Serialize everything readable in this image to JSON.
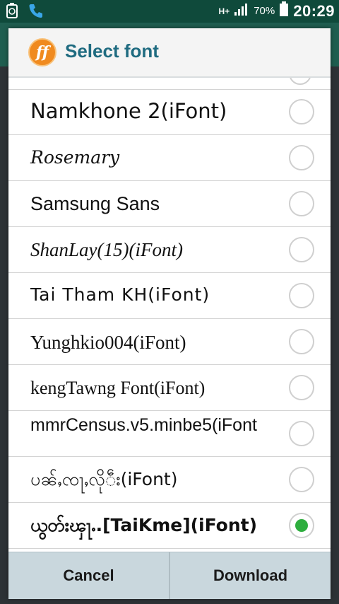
{
  "status_bar": {
    "battery_percent": "70%",
    "time": "20:29",
    "network": "H+",
    "icons": [
      "recycle-icon",
      "phone-icon",
      "signal-icon",
      "battery-icon"
    ]
  },
  "dialog": {
    "logo_text": "ff",
    "title": "Select font",
    "fonts": [
      {
        "label": "Namkhone 2(iFont)",
        "selected": false
      },
      {
        "label": "Rosemary",
        "selected": false
      },
      {
        "label": "Samsung Sans",
        "selected": false
      },
      {
        "label": "ShanLay(15)(iFont)",
        "selected": false
      },
      {
        "label": "Tai  Tham  KH(iFont)",
        "selected": false
      },
      {
        "label": "Yunghkio004(iFont)",
        "selected": false
      },
      {
        "label": "kengTawng Font(iFont)",
        "selected": false
      },
      {
        "label": "mmrCensus.v5.minbe5(iFont",
        "selected": false
      },
      {
        "label": "ပၼ်ႇၸႃႇလိုဵး(iFont)",
        "selected": false
      },
      {
        "label": "ယွတ်းၾႃႉ.[TaiKme](iFont)",
        "selected": true
      }
    ],
    "buttons": {
      "cancel": "Cancel",
      "download": "Download"
    }
  },
  "colors": {
    "accent_title": "#1f6b80",
    "radio_selected": "#2eae3e",
    "status_bar": "#0f4a3b"
  }
}
